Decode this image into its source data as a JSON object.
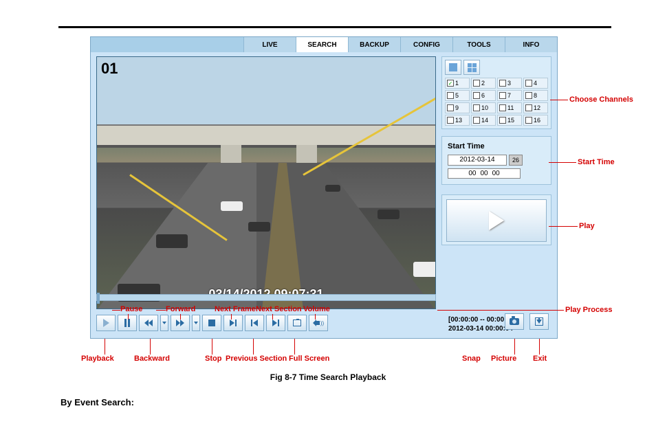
{
  "tabs": {
    "live": "LIVE",
    "search": "SEARCH",
    "backup": "BACKUP",
    "config": "CONFIG",
    "tools": "TOOLS",
    "info": "INFO"
  },
  "video": {
    "channel_badge": "01",
    "osd_timestamp": "03/14/2012 09:07:31"
  },
  "channels": {
    "rows": [
      [
        "1",
        "2",
        "3",
        "4"
      ],
      [
        "5",
        "6",
        "7",
        "8"
      ],
      [
        "9",
        "10",
        "11",
        "12"
      ],
      [
        "13",
        "14",
        "15",
        "16"
      ]
    ],
    "checked": [
      "1"
    ]
  },
  "start_time": {
    "title": "Start Time",
    "date": "2012-03-14",
    "cal_btn": "26",
    "hh": "00",
    "mm": "00",
    "ss": "00"
  },
  "time_info": {
    "range": "[00:00:00 -- 00:00:00]",
    "playhead": "2012-03-14 00:00:04"
  },
  "annotations": {
    "choose_channels": "Choose Channels",
    "start_time": "Start Time",
    "play": "Play",
    "play_process": "Play Process",
    "pause": "Pause",
    "forward": "Forward",
    "next_frame": "Next Frame",
    "next_section": "Next Section",
    "volume": "Volume",
    "playback": "Playback",
    "backward": "Backward",
    "stop": "Stop",
    "previous_section": "Previous Section",
    "full_screen": "Full Screen",
    "snap": "Snap",
    "picture": "Picture",
    "exit": "Exit"
  },
  "caption": "Fig 8-7 Time Search Playback",
  "section_title": "By Event Search:"
}
